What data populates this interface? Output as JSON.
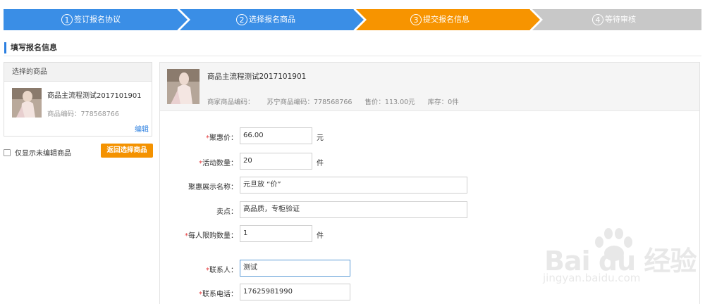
{
  "steps": [
    {
      "num": "1",
      "label": "签订报名协议",
      "state": "done",
      "color": "#3a8ee6"
    },
    {
      "num": "2",
      "label": "选择报名商品",
      "state": "done",
      "color": "#3a8ee6"
    },
    {
      "num": "3",
      "label": "提交报名信息",
      "state": "active",
      "color": "#f79400"
    },
    {
      "num": "4",
      "label": "等待审核",
      "state": "pending",
      "color": "#c8c8c8"
    }
  ],
  "section": {
    "title": "填写报名信息"
  },
  "left": {
    "header": "选择的商品",
    "product_name": "商品主流程测试2017101901",
    "product_code": "商品编码：778568766",
    "edit_label": "编辑",
    "only_unedited_label": "仅显示未编辑商品",
    "back_button": "返回选择商品"
  },
  "product": {
    "name": "商品主流程测试2017101901",
    "merchant_code": "商家商品编码：",
    "suning_code": "苏宁商品编码：778568766",
    "price": "售价：113.00元",
    "stock": "库存：0件"
  },
  "form": {
    "price": {
      "required": "*",
      "label": "聚惠价：",
      "value": "66.00",
      "unit": "元"
    },
    "quantity": {
      "required": "*",
      "label": "活动数量：",
      "value": "20",
      "unit": "件"
    },
    "display_name": {
      "label": "聚惠展示名称：",
      "value": "元旦放 “价”"
    },
    "selling_point": {
      "label": "卖点：",
      "value": "高品质，专柜验证"
    },
    "limit": {
      "required": "*",
      "label": "每人限购数量：",
      "value": "1",
      "unit": "件"
    },
    "contact": {
      "required": "*",
      "label": "联系人：",
      "value": "测试"
    },
    "phone": {
      "required": "*",
      "label": "联系电话：",
      "value": "17625981990"
    }
  },
  "watermark": {
    "main": "Bai du 经验",
    "sub": "jingyan.baidu.com"
  }
}
